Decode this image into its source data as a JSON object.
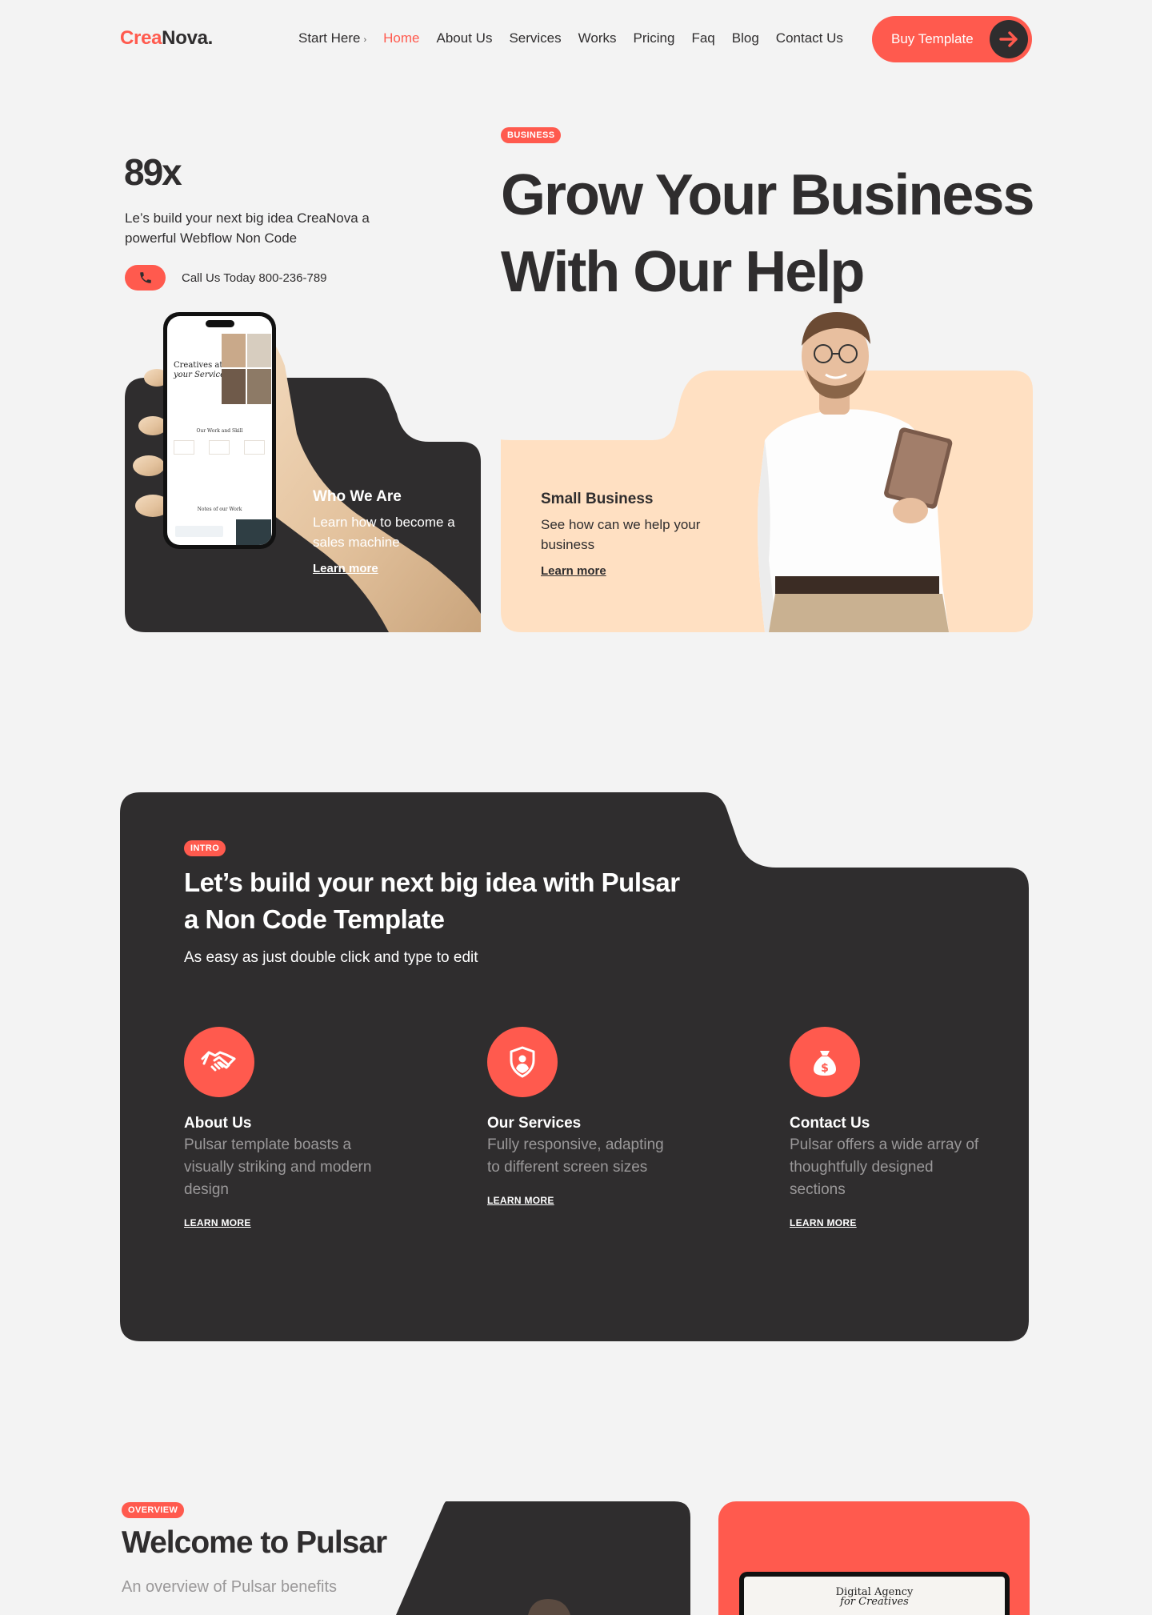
{
  "nav": {
    "logo_part1": "Crea",
    "logo_part2": "Nova.",
    "items": [
      {
        "label": "Start Here",
        "has_chevron": true
      },
      {
        "label": "Home",
        "active": true
      },
      {
        "label": "About Us"
      },
      {
        "label": "Services"
      },
      {
        "label": "Works"
      },
      {
        "label": "Pricing"
      },
      {
        "label": "Faq"
      },
      {
        "label": "Blog"
      },
      {
        "label": "Contact Us"
      }
    ],
    "buy_label": "Buy Template"
  },
  "hero": {
    "stat": "89x",
    "stat_desc": "Le’s build your next big idea CreaNova a powerful Webflow Non Code",
    "call_text": "Call Us Today 800-236-789",
    "badge": "BUSINESS",
    "title_line1": "Grow Your Business",
    "title_line2": "With Our Help",
    "card_dark": {
      "title": "Who We Are",
      "desc": "Learn how to become a sales machine",
      "link": "Learn more"
    },
    "card_peach": {
      "title": "Small Business",
      "desc": "See how can we help your business",
      "link": "Learn more"
    },
    "phone_screen": {
      "headline_1": "Creatives at",
      "headline_2": "your Service",
      "section_1": "Our Work and Skill",
      "section_2": "Notes of our Work"
    }
  },
  "intro": {
    "badge": "INTRO",
    "title": "Let’s build your next big idea with Pulsar a Non Code Template",
    "subtitle": "As easy as just double click and type to edit",
    "features": [
      {
        "icon": "handshake-icon",
        "title": "About Us",
        "desc": "Pulsar template boasts a visually striking and modern design",
        "link": "LEARN MORE"
      },
      {
        "icon": "shield-user-icon",
        "title": "Our Services",
        "desc": "Fully responsive, adapting to different screen sizes",
        "link": "LEARN MORE"
      },
      {
        "icon": "money-bag-icon",
        "title": "Contact Us",
        "desc": "Pulsar offers a wide array of thoughtfully designed sections",
        "link": "LEARN MORE"
      }
    ]
  },
  "overview": {
    "badge": "OVERVIEW",
    "title": "Welcome to Pulsar",
    "subtitle": "An overview of Pulsar benefits",
    "laptop_text_1": "Digital Agency",
    "laptop_text_2": "for Creatives"
  },
  "colors": {
    "accent": "#ff5a4e",
    "dark": "#2f2d2e",
    "peach": "#ffe0c2",
    "background": "#f3f3f3"
  }
}
